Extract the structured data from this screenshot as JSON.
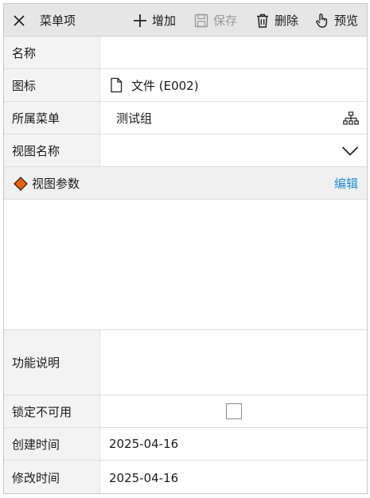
{
  "toolbar": {
    "close_icon": "close-icon",
    "title": "菜单项",
    "add_label": "增加",
    "save_label": "保存",
    "delete_label": "删除",
    "preview_label": "预览"
  },
  "form": {
    "name": {
      "label": "名称",
      "value": ""
    },
    "icon": {
      "label": "图标",
      "value": "文件 (E002)",
      "icon": "file-icon"
    },
    "menu": {
      "label": "所属菜单",
      "value": "测试组",
      "icon": "tree-icon"
    },
    "view_name": {
      "label": "视图名称",
      "value": "",
      "icon": "chevron-down-icon"
    },
    "view_params": {
      "title": "视图参数",
      "edit_label": "编辑",
      "marker_color": "#e8620c"
    },
    "description": {
      "label": "功能说明",
      "value": ""
    },
    "locked": {
      "label": "锁定不可用",
      "checked": false
    },
    "created": {
      "label": "创建时间",
      "value": "2025-04-16"
    },
    "modified": {
      "label": "修改时间",
      "value": "2025-04-16"
    }
  },
  "colors": {
    "accent": "#1e8fd0",
    "diamond": "#e8620c"
  }
}
